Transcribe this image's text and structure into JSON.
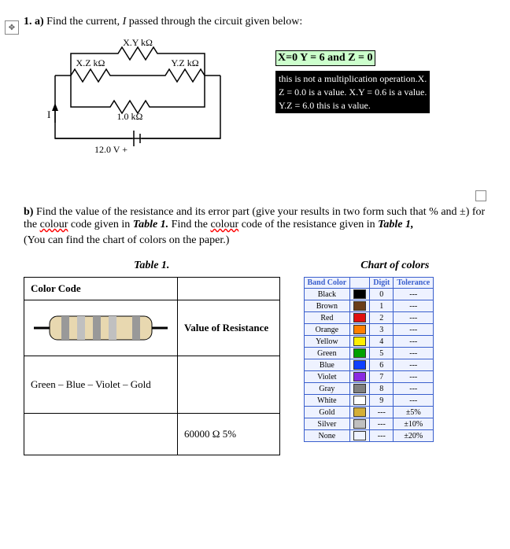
{
  "q1a": {
    "number": "1. a)",
    "text_before_I": " Find the current, ",
    "I": "I",
    "text_after_I": " passed through the circuit given below:"
  },
  "circuit": {
    "top_label": "X.Y kΩ",
    "left_label": "X.Z kΩ",
    "right_label": "Y.Z kΩ",
    "mid_label": "1.0 kΩ",
    "current_label": "I",
    "source_label": "12.0 V  +"
  },
  "anno": {
    "highlight": "X=0 Y = 6 and Z = 0",
    "note_l1": "this is not a multiplication operation.X.",
    "note_l2": "Z = 0.0 is a value. X.Y = 0.6 is a value.",
    "note_l3": "Y.Z = 6.0 this is a value."
  },
  "q1b": {
    "label": "b)",
    "line1_a": " Find the value of the resistance and its error part (give your results in two form such that % and ±) for the ",
    "colour1": "colour",
    "line1_b": " code given in ",
    "table_ref1": "Table 1.",
    "line1_c": " Find the ",
    "colour2": "colour",
    "line1_d": " code of the resistance given in ",
    "table_ref2": "Table 1,",
    "line2": "(You can find the chart of colors on the paper.)"
  },
  "table1": {
    "title": "Table 1.",
    "h_colorcode": "Color Code",
    "h_value": "Value of Resistance",
    "row1_code": "Green – Blue – Violet – Gold",
    "row1_value": "",
    "row2_code": "",
    "row2_value": "60000 Ω 5%"
  },
  "chart": {
    "title": "Chart of colors",
    "h_band": "Band Color",
    "h_digit": "Digit",
    "h_tol": "Tolerance",
    "rows": [
      {
        "name": "Black",
        "color": "#000000",
        "digit": "0",
        "tol": "---"
      },
      {
        "name": "Brown",
        "color": "#6b3e1a",
        "digit": "1",
        "tol": "---"
      },
      {
        "name": "Red",
        "color": "#e01010",
        "digit": "2",
        "tol": "---"
      },
      {
        "name": "Orange",
        "color": "#ff7f00",
        "digit": "3",
        "tol": "---"
      },
      {
        "name": "Yellow",
        "color": "#ffef00",
        "digit": "4",
        "tol": "---"
      },
      {
        "name": "Green",
        "color": "#00a000",
        "digit": "5",
        "tol": "---"
      },
      {
        "name": "Blue",
        "color": "#1040ff",
        "digit": "6",
        "tol": "---"
      },
      {
        "name": "Violet",
        "color": "#8a2be2",
        "digit": "7",
        "tol": "---"
      },
      {
        "name": "Gray",
        "color": "#808080",
        "digit": "8",
        "tol": "---"
      },
      {
        "name": "White",
        "color": "#ffffff",
        "digit": "9",
        "tol": "---"
      },
      {
        "name": "Gold",
        "color": "#d4af37",
        "digit": "---",
        "tol": "±5%"
      },
      {
        "name": "Silver",
        "color": "#c0c0c0",
        "digit": "---",
        "tol": "±10%"
      },
      {
        "name": "None",
        "color": "transparent",
        "digit": "---",
        "tol": "±20%"
      }
    ]
  },
  "resistor_bands": [
    "#999",
    "#c0c0c0",
    "#999",
    "#c0c0c0",
    "#999"
  ]
}
